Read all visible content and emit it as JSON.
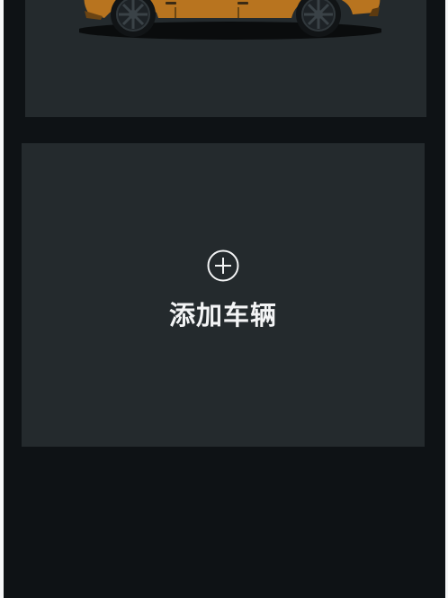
{
  "vehicle_card": {
    "car_image": "orange-car-icon",
    "car_color": "#b8741f"
  },
  "add_vehicle": {
    "icon": "plus-circle-icon",
    "label": "添加车辆"
  },
  "colors": {
    "background": "#0e1215",
    "card": "#242a2d",
    "text": "#f3f4f5"
  }
}
